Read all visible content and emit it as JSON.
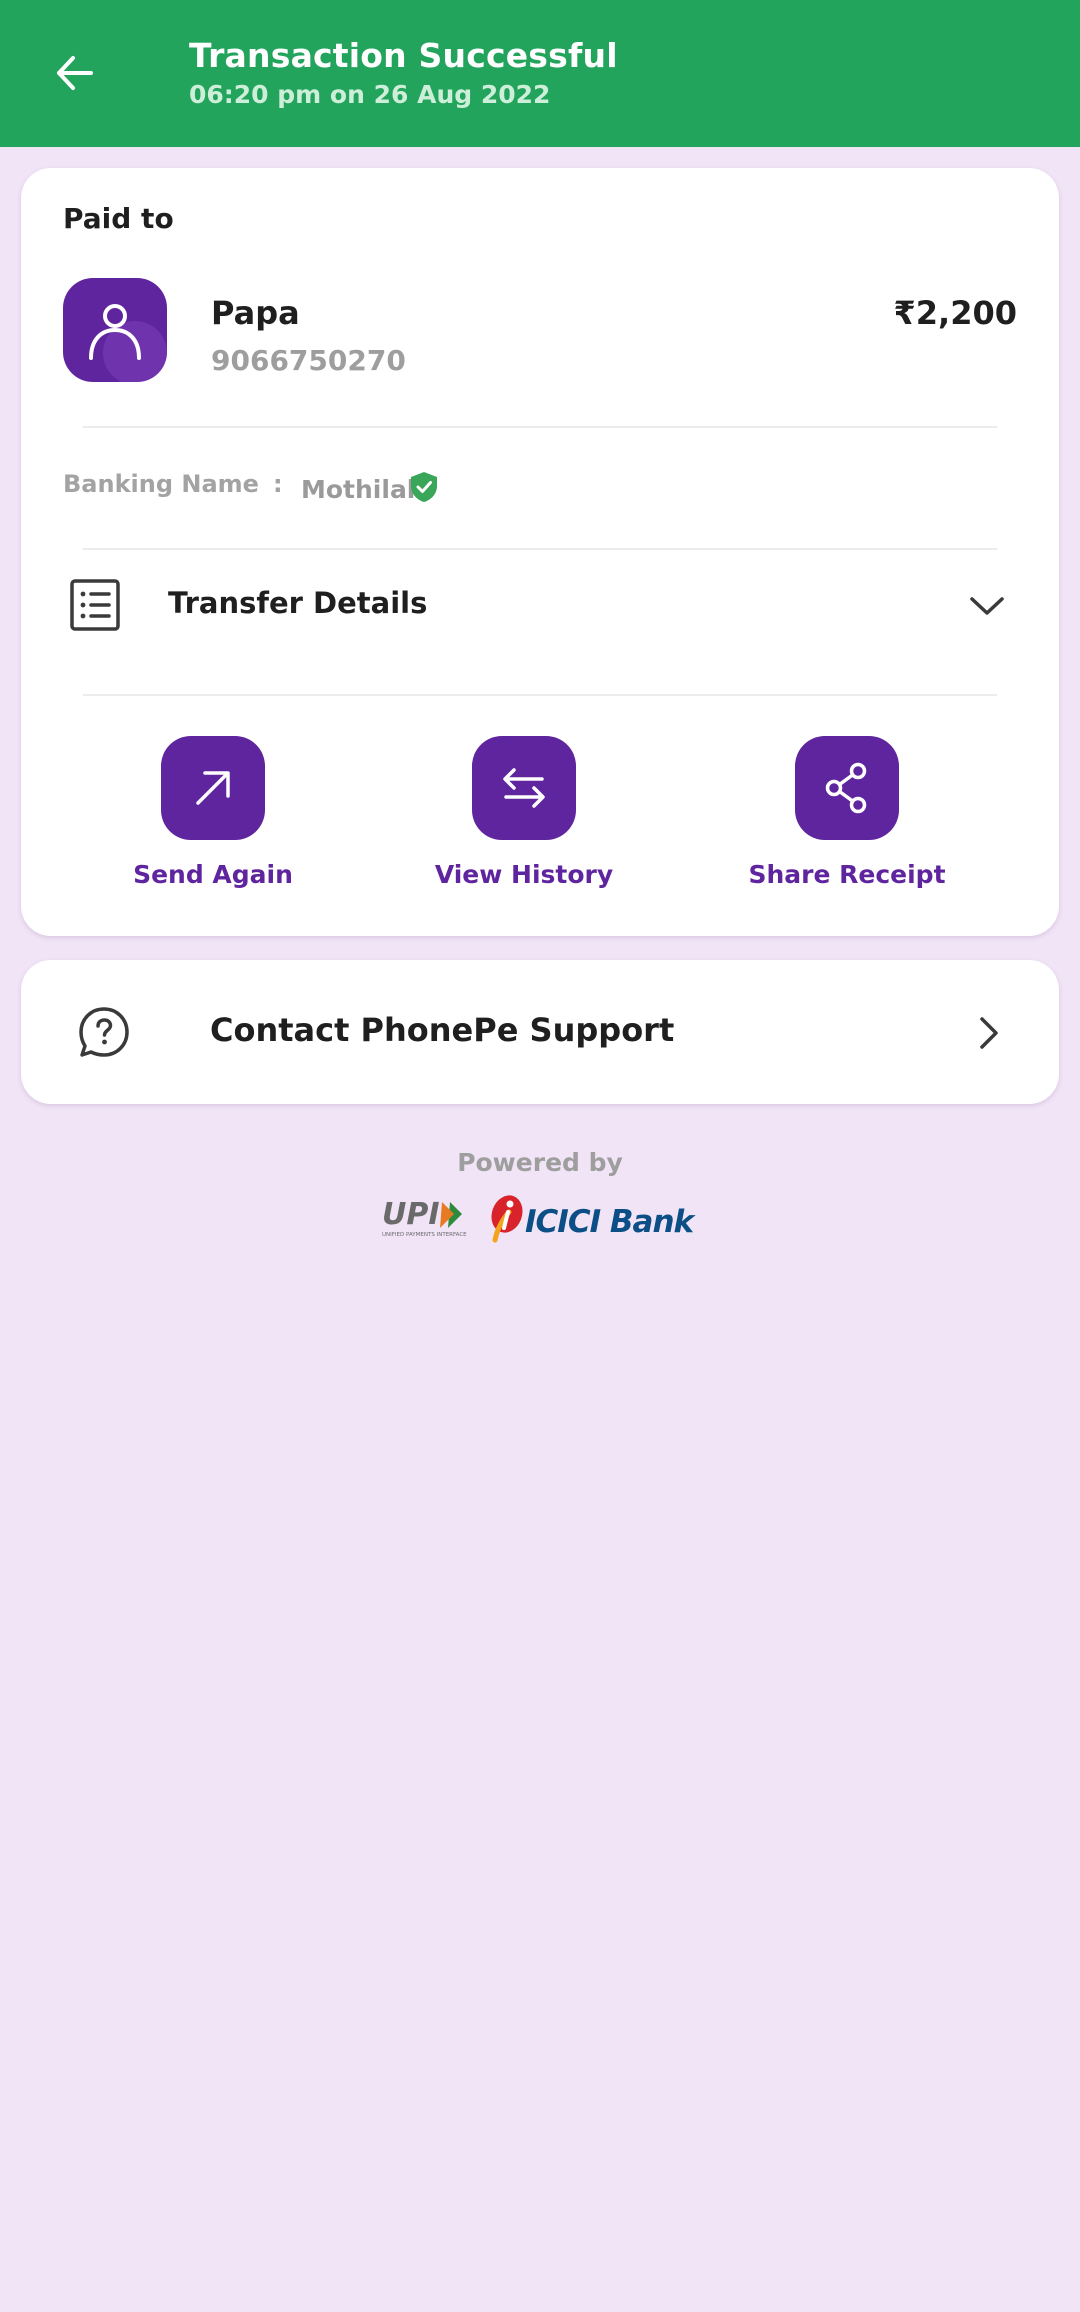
{
  "header": {
    "title": "Transaction Successful",
    "subtitle": "06:20 pm on 26 Aug 2022",
    "background_color": "#23a45c"
  },
  "payment": {
    "paid_to_label": "Paid to",
    "payee_name": "Papa",
    "payee_phone": "9066750270",
    "amount": "₹2,200",
    "banking_name_label": "Banking Name",
    "banking_name_separator": ":",
    "banking_name_value": "Mothilal",
    "transfer_details_label": "Transfer Details"
  },
  "actions": [
    {
      "label": "Send Again",
      "icon": "arrow-up-right-icon"
    },
    {
      "label": "View History",
      "icon": "swap-arrows-icon"
    },
    {
      "label": "Share Receipt",
      "icon": "share-icon"
    }
  ],
  "support": {
    "label": "Contact PhonePe Support",
    "icon": "help-bubble-icon"
  },
  "footer": {
    "powered_by": "Powered by",
    "upi_logo_text": "UPI",
    "upi_tagline": "UNIFIED PAYMENTS INTERFACE",
    "bank_logo_text": "ICICI Bank"
  },
  "colors": {
    "brand_purple": "#5f259f",
    "success_green": "#23a45c",
    "page_background": "#f1e4f6"
  }
}
